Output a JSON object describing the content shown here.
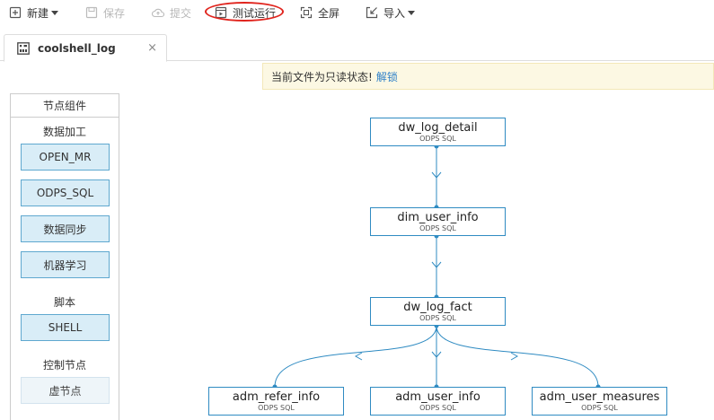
{
  "toolbar": {
    "new_label": "新建",
    "save_label": "保存",
    "submit_label": "提交",
    "test_run_label": "测试运行",
    "fullscreen_label": "全屏",
    "import_label": "导入"
  },
  "tab": {
    "label": "coolshell_log",
    "close": "×"
  },
  "notice": {
    "text": "当前文件为只读状态!",
    "unlock": "解锁"
  },
  "sidebar": {
    "title": "节点组件",
    "sections": [
      {
        "label": "数据加工",
        "items": [
          "OPEN_MR",
          "ODPS_SQL",
          "数据同步",
          "机器学习"
        ]
      },
      {
        "label": "脚本",
        "items": [
          "SHELL"
        ]
      },
      {
        "label": "控制节点",
        "items": [
          "虚节点"
        ]
      }
    ]
  },
  "graph": {
    "nodes": [
      {
        "name": "dw_log_detail",
        "type": "ODPS SQL"
      },
      {
        "name": "dim_user_info",
        "type": "ODPS SQL"
      },
      {
        "name": "dw_log_fact",
        "type": "ODPS SQL"
      },
      {
        "name": "adm_refer_info",
        "type": "ODPS SQL"
      },
      {
        "name": "adm_user_info",
        "type": "ODPS SQL"
      },
      {
        "name": "adm_user_measures",
        "type": "ODPS SQL"
      }
    ],
    "edges": [
      [
        "dw_log_detail",
        "dim_user_info"
      ],
      [
        "dim_user_info",
        "dw_log_fact"
      ],
      [
        "dw_log_fact",
        "adm_refer_info"
      ],
      [
        "dw_log_fact",
        "adm_user_info"
      ],
      [
        "dw_log_fact",
        "adm_user_measures"
      ]
    ]
  },
  "colors": {
    "accent": "#2f8bc2",
    "highlight": "#e0231c",
    "notice_bg": "#fcf8e3"
  }
}
